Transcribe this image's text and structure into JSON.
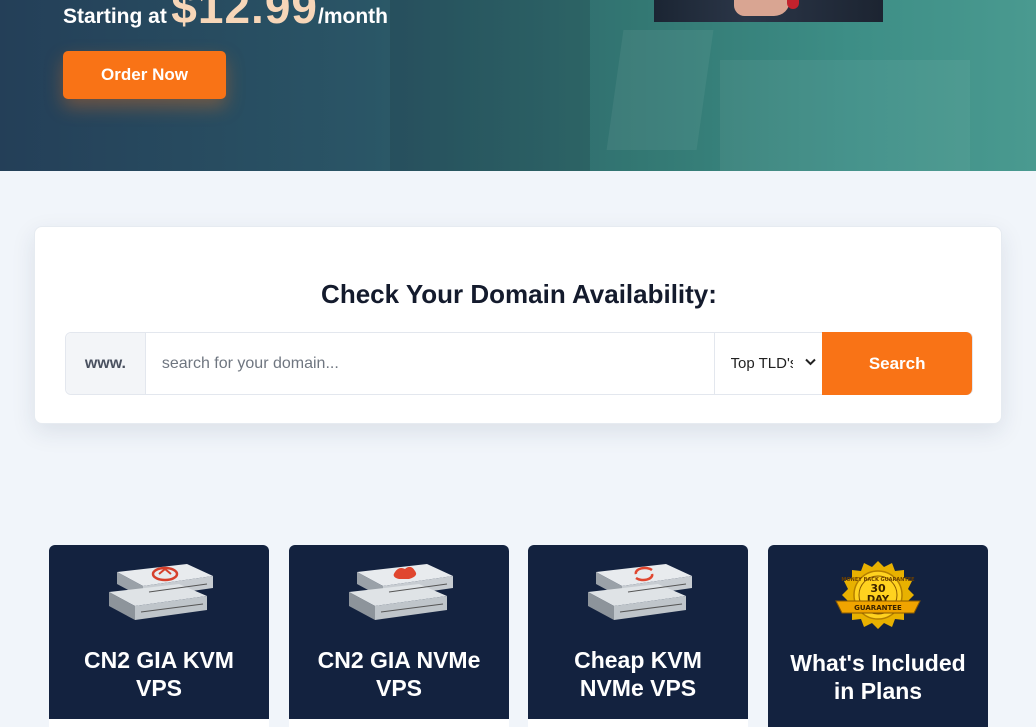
{
  "hero": {
    "price_label": "Starting at",
    "price_amount": "$12.99",
    "price_period": "/month",
    "order_button": "Order Now"
  },
  "domain_search": {
    "title": "Check Your Domain Availability:",
    "prefix": "www.",
    "placeholder": "search for your domain...",
    "tld_selected": "Top TLD's",
    "search_button": "Search"
  },
  "plans": [
    {
      "title_line1": "CN2 GIA KVM",
      "title_line2": "VPS",
      "icon": "server-icon-red-logo"
    },
    {
      "title_line1": "CN2 GIA NVMe",
      "title_line2": "VPS",
      "icon": "server-icon-red-shape"
    },
    {
      "title_line1": "Cheap KVM",
      "title_line2": "NVMe VPS",
      "icon": "server-icon-refresh"
    },
    {
      "title_line1": "What's Included",
      "title_line2": "in Plans",
      "icon": "guarantee-badge-icon",
      "badge": {
        "top": "MONEY BACK GUARANTEE",
        "days": "30",
        "day_word": "DAY",
        "ribbon": "GUARANTEE"
      }
    }
  ],
  "colors": {
    "accent": "#f97316",
    "card_dark": "#13223f",
    "page_bg": "#f1f5fa"
  }
}
